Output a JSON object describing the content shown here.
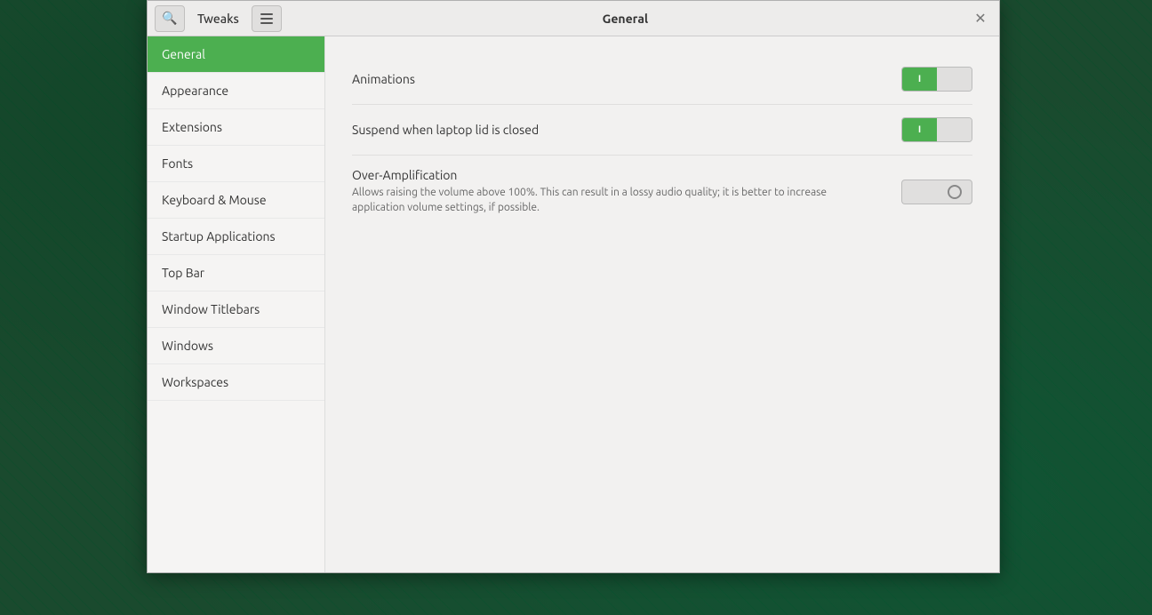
{
  "desktop": {
    "bg_color": "#1a4a2e"
  },
  "window": {
    "title": "General",
    "toolbar": {
      "search_label": "🔍",
      "tweaks_label": "Tweaks",
      "menu_label": "☰",
      "close_label": "✕"
    },
    "sidebar": {
      "items": [
        {
          "id": "general",
          "label": "General",
          "active": true
        },
        {
          "id": "appearance",
          "label": "Appearance",
          "active": false
        },
        {
          "id": "extensions",
          "label": "Extensions",
          "active": false
        },
        {
          "id": "fonts",
          "label": "Fonts",
          "active": false
        },
        {
          "id": "keyboard-mouse",
          "label": "Keyboard & Mouse",
          "active": false
        },
        {
          "id": "startup-applications",
          "label": "Startup Applications",
          "active": false
        },
        {
          "id": "top-bar",
          "label": "Top Bar",
          "active": false
        },
        {
          "id": "window-titlebars",
          "label": "Window Titlebars",
          "active": false
        },
        {
          "id": "windows",
          "label": "Windows",
          "active": false
        },
        {
          "id": "workspaces",
          "label": "Workspaces",
          "active": false
        }
      ]
    },
    "content": {
      "settings": [
        {
          "id": "animations",
          "label": "Animations",
          "sublabel": "",
          "toggle_state": "on"
        },
        {
          "id": "suspend-laptop-lid",
          "label": "Suspend when laptop lid is closed",
          "sublabel": "",
          "toggle_state": "on"
        },
        {
          "id": "over-amplification",
          "label": "Over-Amplification",
          "sublabel": "Allows raising the volume above 100%. This can result in a lossy audio quality; it is better to increase application volume settings, if possible.",
          "toggle_state": "off"
        }
      ]
    }
  }
}
